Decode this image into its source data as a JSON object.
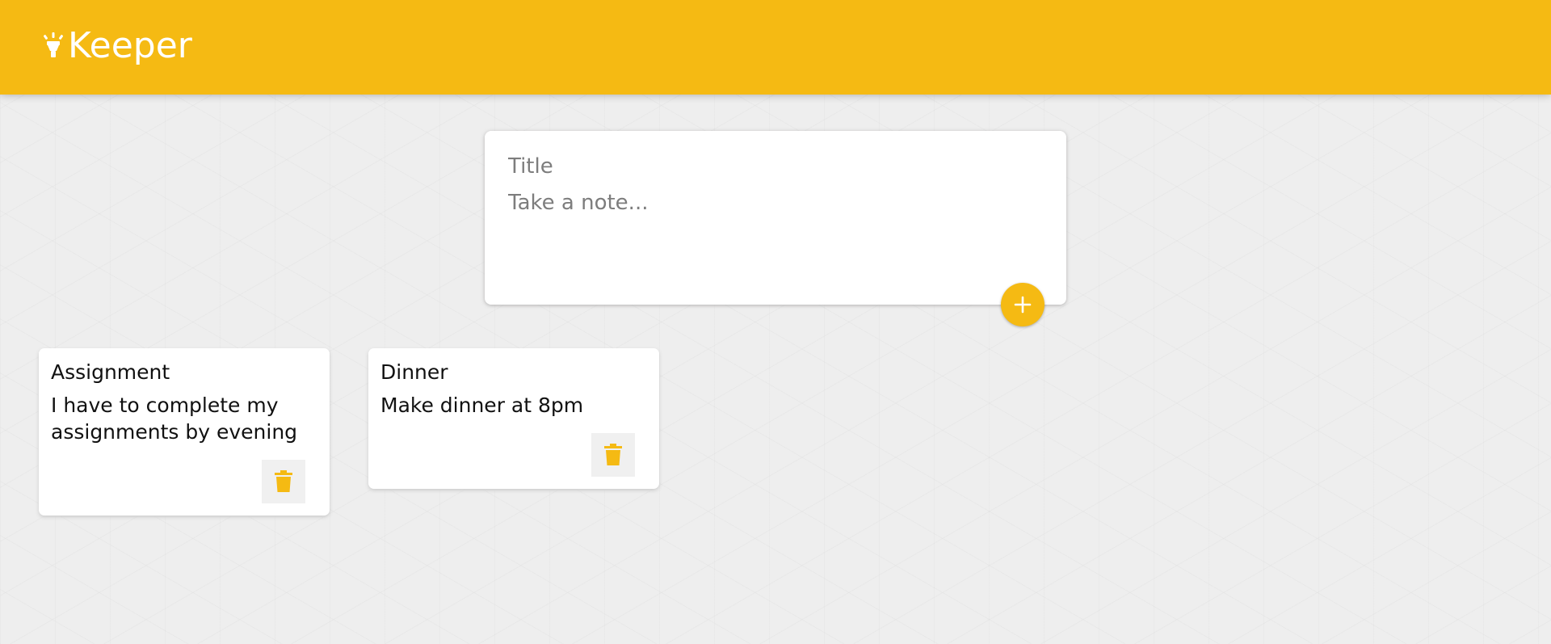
{
  "header": {
    "title": "Keeper",
    "icon": "highlight-lamp-icon"
  },
  "create_note": {
    "title_placeholder": "Title",
    "content_placeholder": "Take a note...",
    "add_icon": "plus-icon"
  },
  "notes": [
    {
      "title": "Assignment",
      "content": "I have to complete my\nassignments by evening",
      "delete_icon": "trash-icon"
    },
    {
      "title": "Dinner",
      "content": "Make dinner at 8pm",
      "delete_icon": "trash-icon"
    }
  ],
  "colors": {
    "accent": "#f5ba13",
    "background": "#eeeeee",
    "card": "#ffffff"
  }
}
